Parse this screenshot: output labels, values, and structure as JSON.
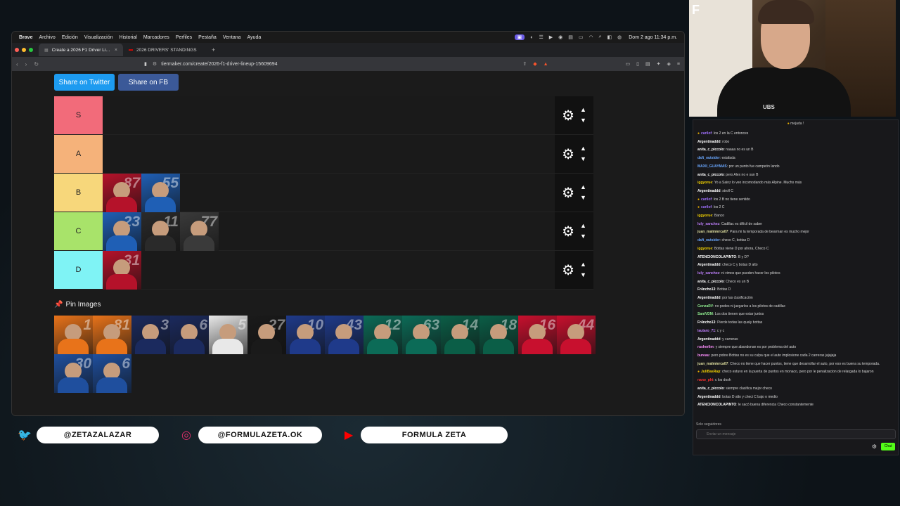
{
  "menubar": {
    "items": [
      "Brave",
      "Archivo",
      "Edición",
      "Visualización",
      "Historial",
      "Marcadores",
      "Perfiles",
      "Pestaña",
      "Ventana",
      "Ayuda"
    ],
    "clock": "Dom 2 ago 11:34 p.m."
  },
  "tabs": [
    {
      "label": "Create a 2026 F1 Driver Lineup",
      "active": true
    },
    {
      "label": "2026 DRIVERS' STANDINGS",
      "active": false
    }
  ],
  "address": {
    "url": "tiermaker.com/create/2026-f1-driver-lineup-15609694"
  },
  "share": {
    "twitter": "Share on Twitter",
    "facebook": "Share on FB"
  },
  "tiers": [
    {
      "label": "S",
      "color": "#f26b7a",
      "drivers": []
    },
    {
      "label": "A",
      "color": "#f5b27a",
      "drivers": []
    },
    {
      "label": "B",
      "color": "#f7d77b",
      "drivers": [
        {
          "num": "87",
          "team_color": "#b5122a"
        },
        {
          "num": "55",
          "team_color": "#1f5fb5"
        }
      ]
    },
    {
      "label": "C",
      "color": "#a8e36a",
      "drivers": [
        {
          "num": "23",
          "team_color": "#1f5fb5"
        },
        {
          "num": "11",
          "team_color": "#2a2a2a"
        },
        {
          "num": "77",
          "team_color": "#3a3a3a"
        }
      ]
    },
    {
      "label": "D",
      "color": "#7ff3f5",
      "drivers": [
        {
          "num": "31",
          "team_color": "#b5122a"
        }
      ]
    }
  ],
  "pin": {
    "title": "Pin Images"
  },
  "pinned_drivers": [
    {
      "num": "1",
      "team_color": "#e8731a"
    },
    {
      "num": "81",
      "team_color": "#e8731a"
    },
    {
      "num": "3",
      "team_color": "#1b2a5e"
    },
    {
      "num": "6",
      "team_color": "#1b2a5e"
    },
    {
      "num": "5",
      "team_color": "#e8e8e8"
    },
    {
      "num": "27",
      "team_color": "#1a1a1a"
    },
    {
      "num": "10",
      "team_color": "#1f3a8a"
    },
    {
      "num": "43",
      "team_color": "#1f3a8a"
    },
    {
      "num": "12",
      "team_color": "#0c6b57"
    },
    {
      "num": "63",
      "team_color": "#0c6b57"
    },
    {
      "num": "14",
      "team_color": "#0b5e47"
    },
    {
      "num": "18",
      "team_color": "#0b5e47"
    },
    {
      "num": "16",
      "team_color": "#c8102e"
    },
    {
      "num": "44",
      "team_color": "#c8102e"
    },
    {
      "num": "30",
      "team_color": "#1f4f9e"
    },
    {
      "num": "6",
      "team_color": "#1f4f9e"
    }
  ],
  "webcam": {
    "badge": "UBS"
  },
  "chat": {
    "top": "mejada !",
    "messages": [
      {
        "user": "carilof",
        "color": "#a070ff",
        "text": "los 2 en la C entonces",
        "badge": true
      },
      {
        "user": "Argentinaddd",
        "color": "#ffffff",
        "text": "robo"
      },
      {
        "user": "anita_c_piccolo",
        "color": "#ffffff",
        "text": "naaaa no es un B"
      },
      {
        "user": "daft_outsider",
        "color": "#6aa8ff",
        "text": "estafada"
      },
      {
        "user": "MAXII_GUAYMAS",
        "color": "#6aa8ff",
        "text": "por un punto fue campeón lando"
      },
      {
        "user": "anita_c_piccolo",
        "color": "#ffffff",
        "text": "pero Alex no e sun B"
      },
      {
        "user": "iggyorue",
        "color": "#f0d000",
        "text": "Yo a Sainz lo veo incomodando más Alpine. Mucho más"
      },
      {
        "user": "Argentinaddd",
        "color": "#ffffff",
        "text": "stroll C"
      },
      {
        "user": "carilof",
        "color": "#a070ff",
        "text": "los 2 B no tiene sentido",
        "badge": true
      },
      {
        "user": "carilof",
        "color": "#a070ff",
        "text": "los 2 C",
        "badge": true
      },
      {
        "user": "iggyorue",
        "color": "#f0d000",
        "text": "Banco"
      },
      {
        "user": "luly_sanchez",
        "color": "#c080ff",
        "text": "Cadillac es difícil de saber"
      },
      {
        "user": "juan_malmierca07",
        "color": "#e0e0a0",
        "text": "Para mi la temporada de bearman es mucho mejor"
      },
      {
        "user": "daft_outsider",
        "color": "#6aa8ff",
        "text": "checo C, bottas D"
      },
      {
        "user": "iggyorue",
        "color": "#f0d000",
        "text": "Bottas viene D por ahora, Checo C"
      },
      {
        "user": "ATENCIONCOLAPINTO",
        "color": "#ffffff",
        "text": "B y D?"
      },
      {
        "user": "Argentinaddd",
        "color": "#ffffff",
        "text": "checo C y botas D alto"
      },
      {
        "user": "luly_sanchez",
        "color": "#c080ff",
        "text": "ni vimos que pueden hacer los pilotos"
      },
      {
        "user": "anita_c_piccolo",
        "color": "#ffffff",
        "text": "Checo es un B"
      },
      {
        "user": "Fr4ncho13",
        "color": "#ffffff",
        "text": "Bottas D"
      },
      {
        "user": "Argentinaddd",
        "color": "#ffffff",
        "text": "por las clasificación"
      },
      {
        "user": "GonzaRV",
        "color": "#90ee90",
        "text": "no podes ni juzgarlos a los pilotos de cadillac"
      },
      {
        "user": "SantVDM",
        "color": "#90ee90",
        "text": "Los dos tienen que estar juntos"
      },
      {
        "user": "Fr4ncho13",
        "color": "#ffffff",
        "text": "Pierde todas las qualy bottas"
      },
      {
        "user": "lautaro_71",
        "color": "#c080ff",
        "text": "c y c"
      },
      {
        "user": "Argentinaddd",
        "color": "#ffffff",
        "text": "y carreras"
      },
      {
        "user": "rusherlim",
        "color": "#ff90ff",
        "text": "y siempre que abandonan es por problema del auto"
      },
      {
        "user": "bureau",
        "color": "#ff90ff",
        "text": "pero pobre Bottas no es su culpa que el auto implosione cada 2 carreras jajajaja"
      },
      {
        "user": "juan_malmierca07",
        "color": "#e0e0a0",
        "text": "Checo no tiene que hacer puntos, tiene que desarrollar el auto, por eso es buena su temporada."
      },
      {
        "user": "JuliBasRap",
        "color": "#f0d000",
        "text": "checo estuvo en la puerta de puntos en monaco, pero por le penalizacion de relargada lo bajaron",
        "badge": true
      },
      {
        "user": "nano_phi",
        "color": "#ff3030",
        "text": "c los dosh"
      },
      {
        "user": "anita_c_piccolo",
        "color": "#ffffff",
        "text": "siempre clasifica mejor checo"
      },
      {
        "user": "Argentinaddd",
        "color": "#ffffff",
        "text": "botas D alto y checi C bajo o medio"
      },
      {
        "user": "ATENCIONCOLAPINTO",
        "color": "#ffffff",
        "text": "le sacó buena diferencia Checo constantemente"
      }
    ],
    "followers": "Solo seguidores",
    "input_placeholder": "Enviar un mensaje",
    "send_label": "Chat"
  },
  "social": [
    {
      "icon": "twitter-icon",
      "handle": "@ZETAZALAZAR",
      "color": "#1d9bf0"
    },
    {
      "icon": "instagram-icon",
      "handle": "@FORMULAZETA.OK",
      "color": "#e1306c"
    },
    {
      "icon": "youtube-icon",
      "handle": "FORMULA ZETA",
      "color": "#ff0000"
    }
  ]
}
